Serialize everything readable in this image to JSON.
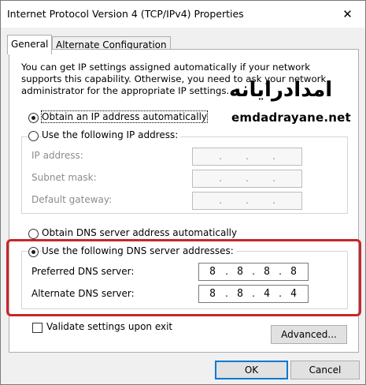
{
  "window": {
    "title": "Internet Protocol Version 4 (TCP/IPv4) Properties",
    "close_glyph": "✕"
  },
  "tabs": [
    {
      "label": "General",
      "active": true
    },
    {
      "label": "Alternate Configuration",
      "active": false
    }
  ],
  "description": "You can get IP settings assigned automatically if your network supports this capability. Otherwise, you need to ask your network administrator for the appropriate IP settings.",
  "ip_section": {
    "auto_label": "Obtain an IP address automatically",
    "auto_selected": true,
    "manual_label": "Use the following IP address:",
    "manual_selected": false,
    "fields": [
      {
        "label": "IP address:",
        "value": ". . ."
      },
      {
        "label": "Subnet mask:",
        "value": ". . ."
      },
      {
        "label": "Default gateway:",
        "value": ". . ."
      }
    ]
  },
  "dns_section": {
    "auto_label": "Obtain DNS server address automatically",
    "auto_selected": false,
    "manual_label": "Use the following DNS server addresses:",
    "manual_selected": true,
    "preferred": {
      "label": "Preferred DNS server:",
      "octets": [
        "8",
        "8",
        "8",
        "8"
      ]
    },
    "alternate": {
      "label": "Alternate DNS server:",
      "octets": [
        "8",
        "8",
        "4",
        "4"
      ]
    }
  },
  "validate": {
    "label": "Validate settings upon exit",
    "checked": false
  },
  "buttons": {
    "advanced": "Advanced...",
    "ok": "OK",
    "cancel": "Cancel"
  },
  "watermark": {
    "arabic": "امدادرایانه",
    "domain": "emdadrayane.net"
  },
  "colors": {
    "highlight_border": "#c8262b",
    "default_button_border": "#0078d7"
  }
}
